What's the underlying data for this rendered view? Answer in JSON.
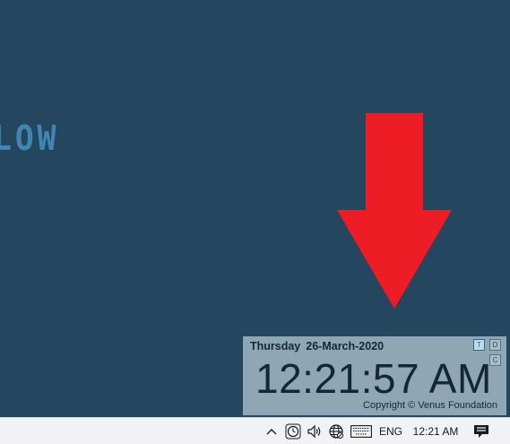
{
  "desktop": {
    "background_text": "LOW",
    "background_color": "#24465f",
    "arrow_color": "#ee1c25"
  },
  "clock_widget": {
    "weekday": "Thursday",
    "date": "26-March-2020",
    "time": "12:21:57 AM",
    "copyright": "Copyright © Venus Foundation",
    "buttons": {
      "t": "T",
      "d": "D",
      "c": "C"
    }
  },
  "taskbar": {
    "show_hidden_icons": "chevron-up-icon",
    "language": "ENG",
    "time": "12:21 AM",
    "icons": [
      "clock-app-icon",
      "volume-icon",
      "network-globe-icon",
      "keyboard-icon",
      "notification-icon"
    ]
  }
}
